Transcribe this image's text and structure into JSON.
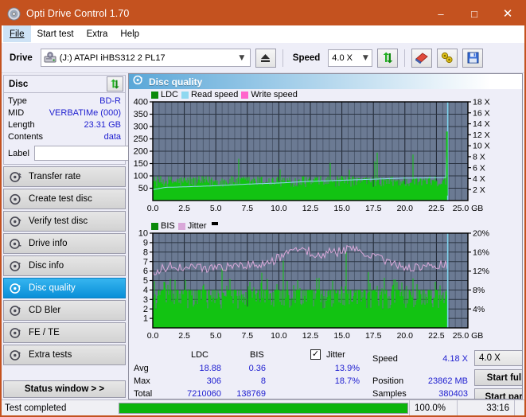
{
  "window": {
    "title": "Opti Drive Control 1.70",
    "icon": "disc-icon",
    "minimize": "–",
    "maximize": "□",
    "close": "✕"
  },
  "menu": {
    "items": [
      {
        "label": "File",
        "active": true
      },
      {
        "label": "Start test",
        "active": false
      },
      {
        "label": "Extra",
        "active": false
      },
      {
        "label": "Help",
        "active": false
      }
    ]
  },
  "toolbar": {
    "drive_label": "Drive",
    "drive_value": "(J:)  ATAPI iHBS312  2 PL17",
    "eject_icon": "eject-icon",
    "speed_label": "Speed",
    "speed_value": "4.0 X",
    "refresh_icon": "refresh-icon",
    "erase_icon": "eraser-icon",
    "tools_icon": "tools-icon",
    "save_icon": "save-disk-icon"
  },
  "sidebar": {
    "disc_panel": {
      "title": "Disc",
      "refresh_icon": "refresh-icon",
      "rows": [
        {
          "key": "Type",
          "value": "BD-R"
        },
        {
          "key": "MID",
          "value": "VERBATIMe (000)"
        },
        {
          "key": "Length",
          "value": "23.31 GB"
        },
        {
          "key": "Contents",
          "value": "data"
        }
      ],
      "label_key": "Label",
      "label_value": "",
      "label_placeholder": "",
      "label_button_icon": "disc-label-icon"
    },
    "nav": [
      {
        "label": "Transfer rate",
        "icon": "disc-speed-icon",
        "selected": false
      },
      {
        "label": "Create test disc",
        "icon": "disc-create-icon",
        "selected": false
      },
      {
        "label": "Verify test disc",
        "icon": "disc-verify-icon",
        "selected": false
      },
      {
        "label": "Drive info",
        "icon": "drive-info-icon",
        "selected": false
      },
      {
        "label": "Disc info",
        "icon": "disc-info-icon",
        "selected": false
      },
      {
        "label": "Disc quality",
        "icon": "disc-quality-icon",
        "selected": true
      },
      {
        "label": "CD Bler",
        "icon": "cd-bler-icon",
        "selected": false
      },
      {
        "label": "FE / TE",
        "icon": "fe-te-icon",
        "selected": false
      },
      {
        "label": "Extra tests",
        "icon": "extra-tests-icon",
        "selected": false
      }
    ],
    "status_window_button": "Status window > >"
  },
  "main": {
    "header_title": "Disc quality",
    "header_icon": "disc-quality-icon"
  },
  "stats": {
    "col_ldc": "LDC",
    "col_bis": "BIS",
    "jitter_label": "Jitter",
    "jitter_checked": true,
    "rows": [
      {
        "name": "Avg",
        "ldc": "18.88",
        "bis": "0.36",
        "jitter": "13.9%"
      },
      {
        "name": "Max",
        "ldc": "306",
        "bis": "8",
        "jitter": "18.7%"
      },
      {
        "name": "Total",
        "ldc": "7210060",
        "bis": "138769",
        "jitter": ""
      }
    ],
    "speed_label": "Speed",
    "speed_value": "4.18 X",
    "position_label": "Position",
    "position_value": "23862 MB",
    "samples_label": "Samples",
    "samples_value": "380403",
    "speed_select": "4.0 X",
    "start_full_button": "Start full",
    "start_part_button": "Start part"
  },
  "statusbar": {
    "message": "Test completed",
    "percent_text": "100.0%",
    "percent_value": 100,
    "elapsed": "33:16"
  },
  "colors": {
    "titlebar": "#c4521f",
    "accent_blue": "#2020d0",
    "plot_bg": "#6b7a93",
    "ldc_green": "#12c312",
    "read_speed": "#8fd8f0",
    "write_speed": "#ff66cc",
    "jitter_pink": "#d9a8d9",
    "progress_green": "#0cb40c",
    "selected_nav": "#0a8fd8"
  },
  "chart_data": [
    {
      "type": "area",
      "name": "top-chart",
      "title": "",
      "xlabel": "GB",
      "ylabel": "",
      "xlim": [
        0,
        25
      ],
      "ylim": [
        0,
        400
      ],
      "y2lim": [
        0,
        18
      ],
      "grid": true,
      "legend_position": "top-left",
      "xticks": [
        "0.0",
        "2.5",
        "5.0",
        "7.5",
        "10.0",
        "12.5",
        "15.0",
        "17.5",
        "20.0",
        "22.5",
        "25.0 GB"
      ],
      "xtick_values": [
        0,
        2.5,
        5,
        7.5,
        10,
        12.5,
        15,
        17.5,
        20,
        22.5,
        25
      ],
      "yticks": [
        "400",
        "350",
        "300",
        "250",
        "200",
        "150",
        "100",
        "50"
      ],
      "ytick_values": [
        400,
        350,
        300,
        250,
        200,
        150,
        100,
        50
      ],
      "y2ticks": [
        "18 X",
        "16 X",
        "14 X",
        "12 X",
        "10 X",
        "8 X",
        "6 X",
        "4 X",
        "2 X"
      ],
      "y2tick_values": [
        18,
        16,
        14,
        12,
        10,
        8,
        6,
        4,
        2
      ],
      "data_end_x": 23.4,
      "legend": [
        {
          "name": "LDC",
          "color": "#12c312"
        },
        {
          "name": "Read speed",
          "color": "#8fd8f0"
        },
        {
          "name": "Write speed",
          "color": "#ff66cc"
        }
      ],
      "series": [
        {
          "name": "LDC",
          "color": "#12c312",
          "kind": "spikes",
          "baseline": 55,
          "noise": 45,
          "spike_max": 306,
          "values_summary": {
            "avg": 18.88,
            "max": 306,
            "total": 7210060
          }
        },
        {
          "name": "Read speed",
          "color": "#8fd8f0",
          "kind": "line",
          "axis": "right",
          "x": [
            0.0,
            1.0,
            2.5,
            5.0,
            7.5,
            10.0,
            12.5,
            15.0,
            17.5,
            20.0,
            22.5,
            23.3,
            23.4
          ],
          "values": [
            2.0,
            2.4,
            2.5,
            2.7,
            3.0,
            3.2,
            3.5,
            3.7,
            3.9,
            4.1,
            4.15,
            4.18,
            18.0
          ]
        }
      ]
    },
    {
      "type": "area",
      "name": "bottom-chart",
      "title": "",
      "xlabel": "GB",
      "ylabel": "",
      "xlim": [
        0,
        25
      ],
      "ylim": [
        0,
        10
      ],
      "y2lim": [
        0,
        20
      ],
      "grid": true,
      "legend_position": "top-left",
      "xticks": [
        "0.0",
        "2.5",
        "5.0",
        "7.5",
        "10.0",
        "12.5",
        "15.0",
        "17.5",
        "20.0",
        "22.5",
        "25.0 GB"
      ],
      "xtick_values": [
        0,
        2.5,
        5,
        7.5,
        10,
        12.5,
        15,
        17.5,
        20,
        22.5,
        25
      ],
      "yticks": [
        "10",
        "9",
        "8",
        "7",
        "6",
        "5",
        "4",
        "3",
        "2",
        "1"
      ],
      "ytick_values": [
        10,
        9,
        8,
        7,
        6,
        5,
        4,
        3,
        2,
        1
      ],
      "y2ticks": [
        "20%",
        "16%",
        "12%",
        "8%",
        "4%"
      ],
      "y2tick_values": [
        20,
        16,
        12,
        8,
        4
      ],
      "data_end_x": 23.4,
      "legend": [
        {
          "name": "BIS",
          "color": "#12c312"
        },
        {
          "name": "Jitter",
          "color": "#d9a8d9"
        },
        {
          "name": "marker",
          "color": "#000000"
        }
      ],
      "series": [
        {
          "name": "BIS",
          "color": "#12c312",
          "kind": "spikes",
          "baseline": 4,
          "noise": 1.5,
          "spike_max": 8,
          "values_summary": {
            "avg": 0.36,
            "max": 8,
            "total": 138769
          }
        },
        {
          "name": "Jitter",
          "color": "#d9a8d9",
          "kind": "noise-line",
          "axis": "right",
          "x": [
            0.0,
            1.0,
            2.5,
            5.0,
            7.5,
            9.5,
            11.8,
            13.0,
            15.0,
            16.0,
            17.5,
            19.0,
            20.5,
            22.0,
            23.3
          ],
          "values": [
            12.0,
            12.8,
            13.0,
            12.6,
            13.2,
            14.2,
            16.8,
            15.5,
            16.2,
            16.8,
            15.4,
            13.6,
            12.6,
            13.2,
            13.4
          ],
          "values_summary": {
            "avg": 13.9,
            "max": 18.7
          }
        }
      ]
    }
  ]
}
